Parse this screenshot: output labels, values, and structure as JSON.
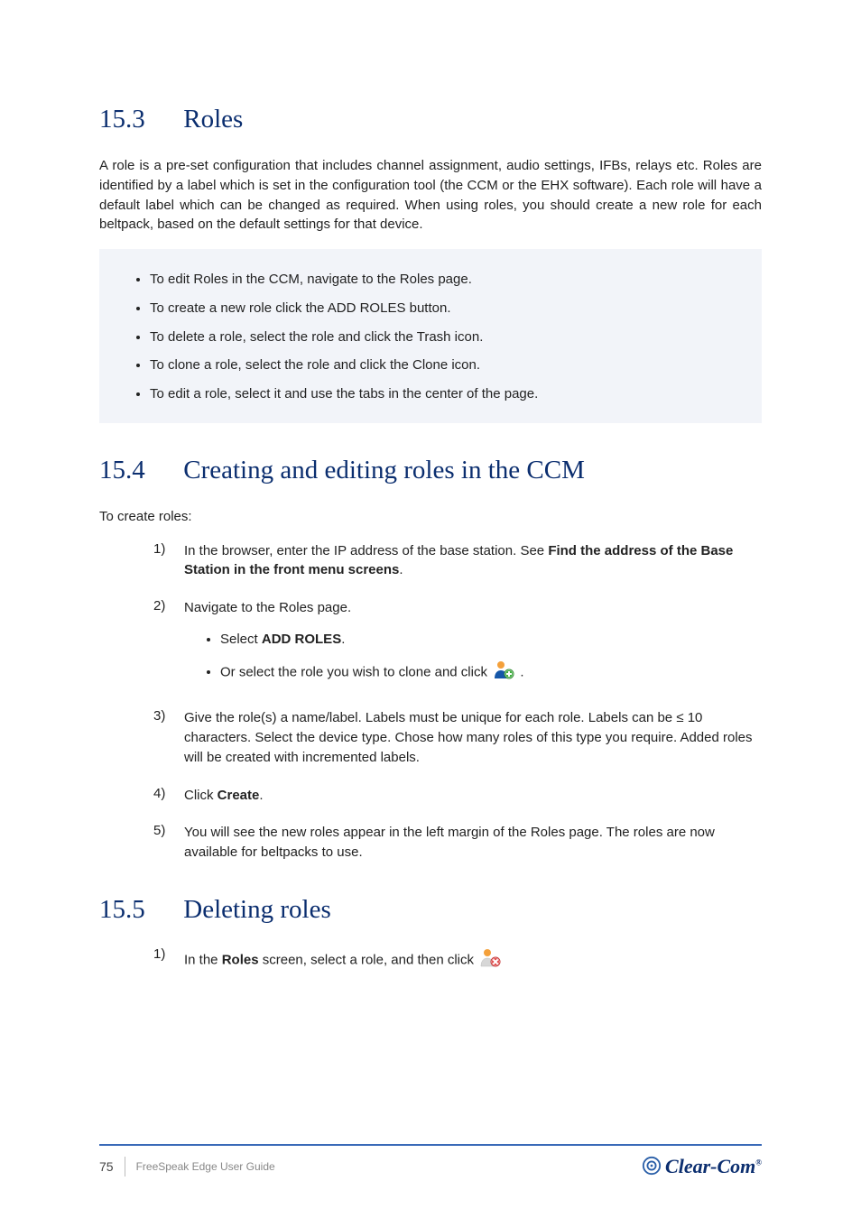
{
  "sections": {
    "roles": {
      "number": "15.3",
      "title": "Roles",
      "intro": "A role is a pre-set configuration that includes channel assignment, audio settings, IFBs, relays etc. Roles are identified by a label which is set in the configuration tool (the CCM or the EHX software). Each role will have a default label which can be changed as required. When using roles, you should create a new role for each beltpack, based on the default settings for that device.",
      "bullets": [
        "To edit Roles in the CCM, navigate to the Roles page.",
        "To create a new role click the ADD ROLES button.",
        "To delete a role, select the role and click the Trash icon.",
        "To clone a role, select the role and click the Clone icon.",
        "To edit a role, select it and use the tabs in the center of the page."
      ]
    },
    "creating": {
      "number": "15.4",
      "title": "Creating and editing roles in the CCM",
      "intro": "To create roles:",
      "steps": [
        {
          "n": "1)",
          "text_a": "In the browser, enter the IP address of the base station. See ",
          "link": "Find the address of the Base Station in the front menu screens",
          "text_b": "."
        },
        {
          "n": "2)",
          "text": "Navigate to the Roles page.",
          "sub": [
            {
              "text_a": "Select ",
              "bold": "ADD ROLES",
              "text_b": "."
            },
            {
              "text_a": "Or select the role you wish to clone and click ",
              "iconName": "add-user-icon",
              "iconType": "add",
              "text_b": "."
            }
          ]
        },
        {
          "n": "3)",
          "text": "Give the role(s) a name/label. Labels must be unique for each role. Labels can be ≤ 10 characters. Select the device type. Chose how many roles of this type you require. Added roles will be created with incremented labels."
        },
        {
          "n": "4)",
          "text_a": "Click ",
          "bold": "Create",
          "text_b": "."
        },
        {
          "n": "5)",
          "text": "You will see the new roles appear in the left margin of the Roles page. The roles are now available for beltpacks to use."
        }
      ]
    },
    "deleting": {
      "number": "15.5",
      "title": "Deleting roles",
      "step": {
        "n": "1)",
        "text_a": "In the ",
        "bold": "Roles",
        "text_b": " screen, select a role, and then click "
      },
      "iconName": "delete-user-icon",
      "iconType": "delete"
    }
  },
  "icons": {
    "add_user_title": "Add user",
    "delete_user_title": "Delete user"
  },
  "footer": {
    "page": "75",
    "guide": "FreeSpeak Edge User Guide",
    "logo_text": "Clear-Com",
    "reg": "®"
  }
}
